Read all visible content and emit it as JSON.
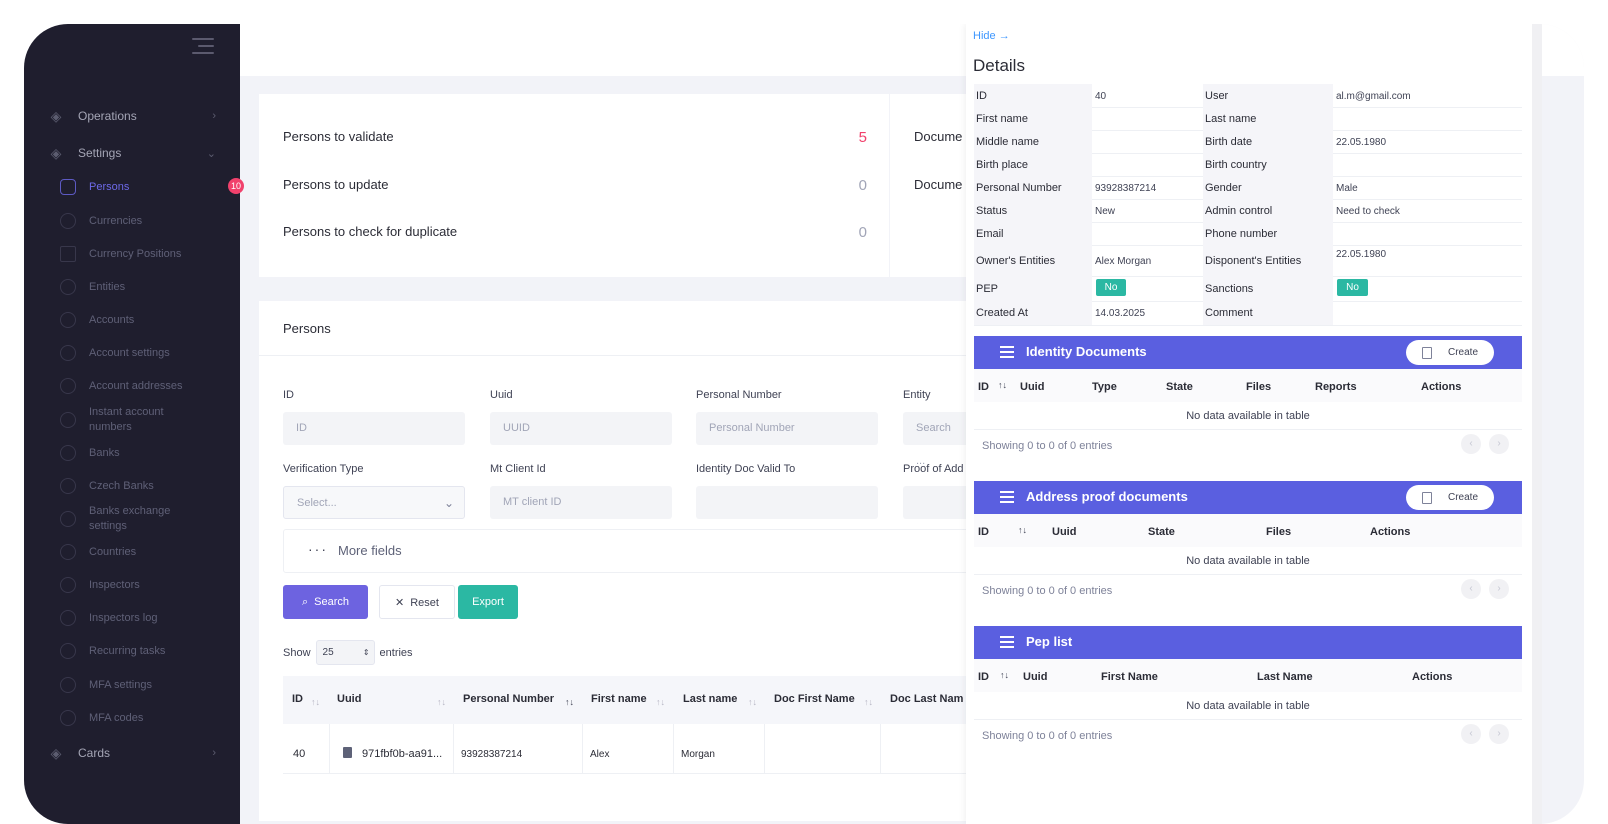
{
  "sidebar": {
    "sections": [
      {
        "label": "Operations",
        "icon": "layers-icon"
      },
      {
        "label": "Settings",
        "icon": "layers-icon"
      },
      {
        "label": "Cards",
        "icon": "layers-icon"
      }
    ],
    "items": [
      {
        "label": "Persons",
        "badge": "10",
        "active": true
      },
      {
        "label": "Currencies"
      },
      {
        "label": "Currency Positions"
      },
      {
        "label": "Entities"
      },
      {
        "label": "Accounts"
      },
      {
        "label": "Account settings"
      },
      {
        "label": "Account addresses"
      },
      {
        "label": "Instant account numbers"
      },
      {
        "label": "Banks"
      },
      {
        "label": "Czech Banks"
      },
      {
        "label": "Banks exchange settings"
      },
      {
        "label": "Countries"
      },
      {
        "label": "Inspectors"
      },
      {
        "label": "Inspectors log"
      },
      {
        "label": "Recurring tasks"
      },
      {
        "label": "MFA settings"
      },
      {
        "label": "MFA codes"
      }
    ]
  },
  "stats": [
    {
      "label": "Persons to validate",
      "value": "5"
    },
    {
      "label": "Persons to update",
      "value": "0"
    },
    {
      "label": "Persons to check for duplicate",
      "value": "0"
    }
  ],
  "stats_right": [
    "Docume",
    "Docume"
  ],
  "persons": {
    "title": "Persons",
    "filters": {
      "id": {
        "label": "ID",
        "placeholder": "ID"
      },
      "uuid": {
        "label": "Uuid",
        "placeholder": "UUID"
      },
      "personal_number": {
        "label": "Personal Number",
        "placeholder": "Personal Number"
      },
      "entity": {
        "label": "Entity",
        "placeholder": "Search ..."
      },
      "verification_type": {
        "label": "Verification Type",
        "placeholder": "Select..."
      },
      "mt_client_id": {
        "label": "Mt Client Id",
        "placeholder": "MT client ID"
      },
      "identity_doc_valid_to": {
        "label": "Identity Doc Valid To",
        "placeholder": ""
      },
      "proof_of_address": {
        "label": "Proof of Add"
      }
    },
    "more_fields": "More fields",
    "buttons": {
      "search": "Search",
      "reset": "Reset",
      "export": "Export"
    },
    "show": "Show",
    "entries_value": "25",
    "entries": "entries",
    "columns": [
      "ID",
      "Uuid",
      "Personal Number",
      "First name",
      "Last name",
      "Doc First Name",
      "Doc Last Nam"
    ],
    "rows": [
      {
        "id": "40",
        "uuid": "971fbf0b-aa91...",
        "personal_number": "93928387214",
        "first_name": "Alex",
        "last_name": "Morgan"
      }
    ]
  },
  "panel": {
    "hide": "Hide",
    "title": "Details",
    "left": [
      {
        "k": "ID",
        "v": "40"
      },
      {
        "k": "First name",
        "v": ""
      },
      {
        "k": "Middle name",
        "v": ""
      },
      {
        "k": "Birth place",
        "v": ""
      },
      {
        "k": "Personal Number",
        "v": "93928387214"
      },
      {
        "k": "Status",
        "v": "New"
      },
      {
        "k": "Email",
        "v": ""
      },
      {
        "k": "Owner's Entities",
        "v": "Alex Morgan"
      },
      {
        "k": "PEP",
        "v": "No"
      },
      {
        "k": "Created At",
        "v": "14.03.2025"
      }
    ],
    "right": [
      {
        "k": "User",
        "v": "al.m@gmail.com"
      },
      {
        "k": "Last name",
        "v": ""
      },
      {
        "k": "Birth date",
        "v": "22.05.1980"
      },
      {
        "k": "Birth country",
        "v": ""
      },
      {
        "k": "Gender",
        "v": "Male"
      },
      {
        "k": "Admin control",
        "v": "Need to check"
      },
      {
        "k": "Phone number",
        "v": ""
      },
      {
        "k": "Disponent's Entities",
        "v": "22.05.1980"
      },
      {
        "k": "Sanctions",
        "v": "No"
      },
      {
        "k": "Comment",
        "v": ""
      }
    ],
    "sections": [
      {
        "title": "Identity Documents",
        "create": "Create",
        "columns": [
          "ID",
          "Uuid",
          "Type",
          "State",
          "Files",
          "Reports",
          "Actions"
        ],
        "empty": "No data available in table",
        "showing": "Showing 0 to 0 of 0 entries"
      },
      {
        "title": "Address proof documents",
        "create": "Create",
        "columns": [
          "ID",
          "Uuid",
          "State",
          "Files",
          "Actions"
        ],
        "empty": "No data available in table",
        "showing": "Showing 0 to 0 of 0 entries"
      },
      {
        "title": "Pep list",
        "columns": [
          "ID",
          "Uuid",
          "First Name",
          "Last Name",
          "Actions"
        ],
        "empty": "No data available in table",
        "showing": "Showing 0 to 0 of 0 entries"
      }
    ]
  },
  "colors": {
    "sidebar": "#1f1e2e",
    "accent": "#5a5fe0",
    "primary_button": "#6d63e0",
    "export": "#2bb8a3",
    "badge": "#f1416c"
  }
}
